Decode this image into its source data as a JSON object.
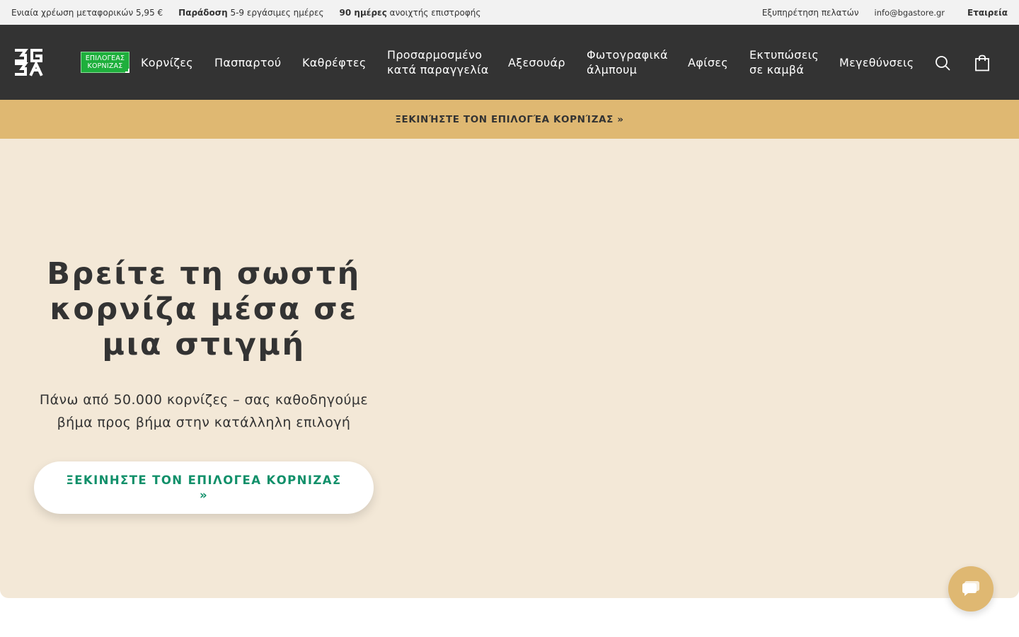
{
  "topbar": {
    "shipping": "Ενιαία χρέωση μεταφορικών 5,95 €",
    "delivery_bold": "Παράδοση",
    "delivery_rest": " 5-9 εργάσιμες ημέρες",
    "returns_bold": "90 ημέρες",
    "returns_rest": " ανοιχτής επιστροφής",
    "customer_service": "Εξυπηρέτηση πελατών",
    "email": "info@bgastore.gr",
    "company": "Εταιρεία"
  },
  "header": {
    "logo_text": "BGA",
    "selector_badge": [
      "ΕΠΙΛΟΓΕΑΣ",
      "ΚΟΡΝΙΖΑΣ"
    ],
    "nav": [
      {
        "label": "Κορνίζες"
      },
      {
        "label": "Πασπαρτού"
      },
      {
        "label": "Καθρέφτες"
      },
      {
        "label": "Προσαρμοσμένο κατά παραγγελία"
      },
      {
        "label": "Αξεσουάρ"
      },
      {
        "label": "Φωτογραφικά άλμπουμ"
      },
      {
        "label": "Αφίσες"
      },
      {
        "label": "Εκτυπώσεις σε καμβά"
      },
      {
        "label": "Μεγεθύνσεις"
      }
    ],
    "icons": {
      "search": "search-icon",
      "cart": "shopping-bag-icon"
    }
  },
  "banner": {
    "label": "ΞΕΚΙΝΉΣΤΕ ΤΟΝ ΕΠΙΛΟΓΈΑ ΚΟΡΝΊΖΑΣ »"
  },
  "hero": {
    "title": "Βρείτε τη σωστή κορνίζα μέσα σε μια στιγμή",
    "subtitle": "Πάνω από 50.000 κορνίζες – σας καθοδηγούμε βήμα προς βήμα στην κατάλληλη επιλογή",
    "cta_label": "ΞΕΚΙΝΗΣΤΕ ΤΟΝ ΕΠΙΛΟΓΕΑ ΚΟΡΝΙΖΑΣ »"
  },
  "chat": {
    "icon": "chat-bubble-icon"
  },
  "colors": {
    "topbar_bg": "#f2f2f2",
    "header_bg": "#333333",
    "banner_bg": "#dfb872",
    "hero_bg": "#f3e8d7",
    "cta_text": "#11906a",
    "badge_green": "#1eaf3c"
  }
}
